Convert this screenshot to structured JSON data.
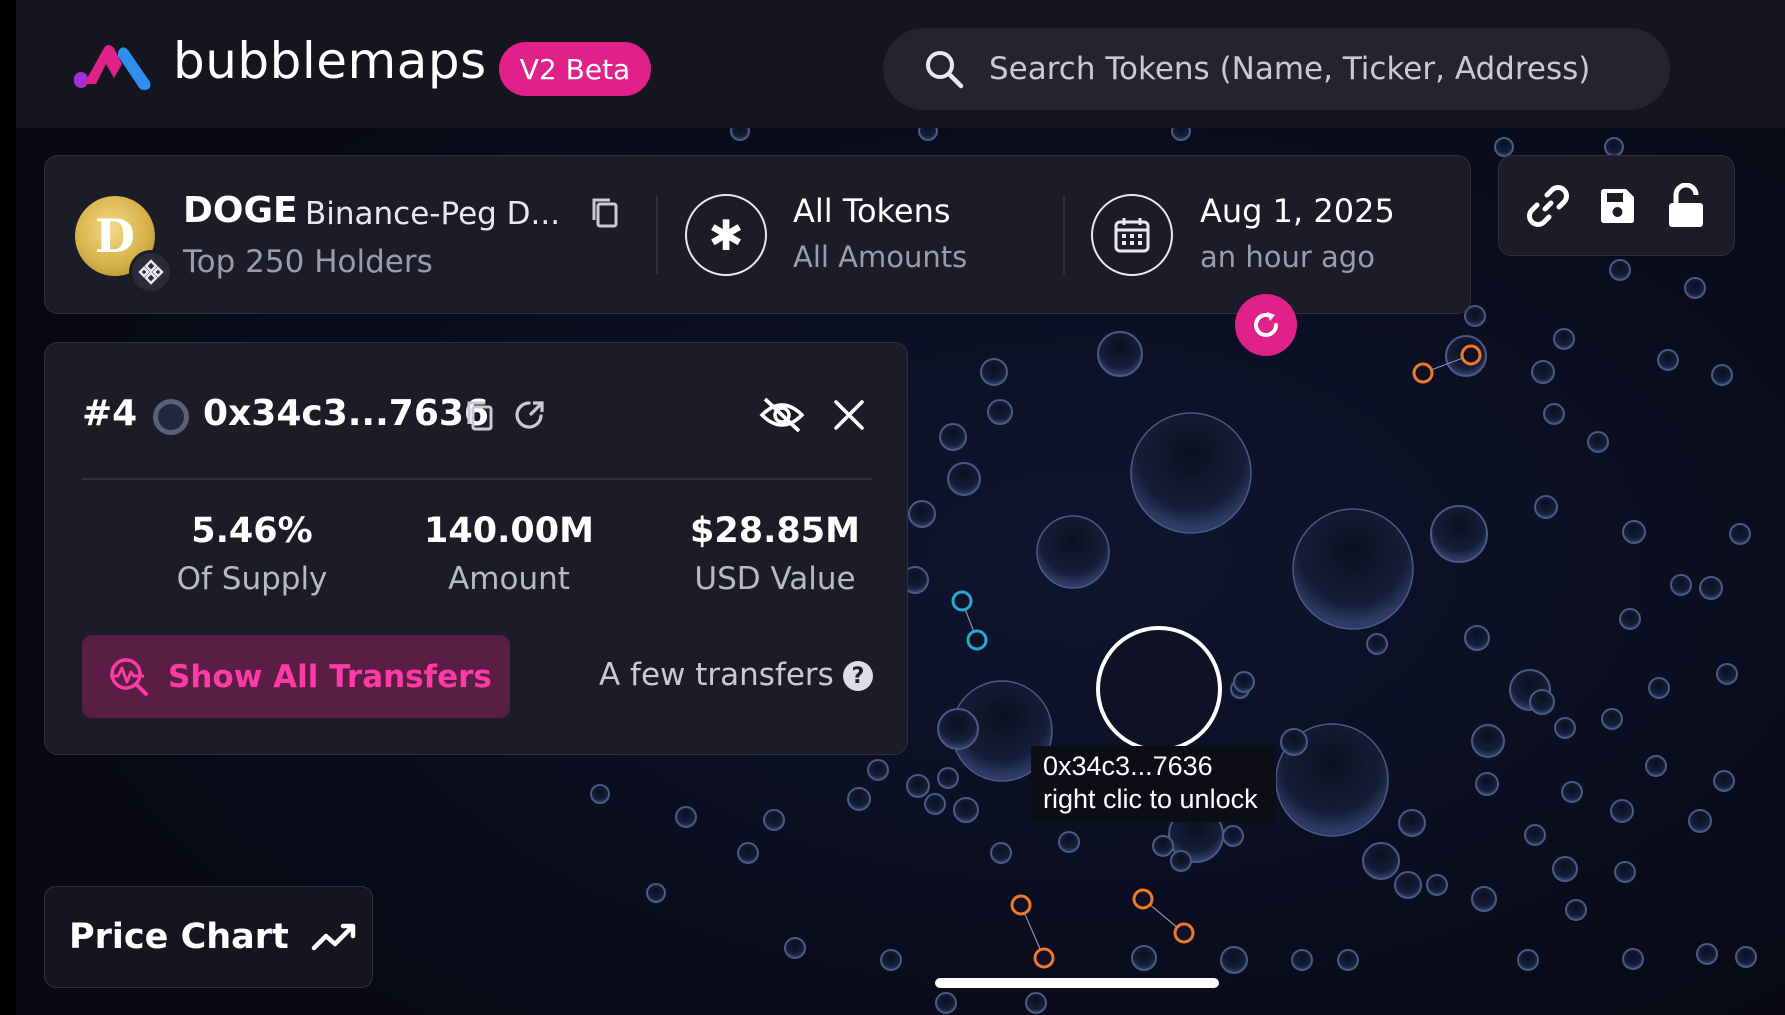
{
  "header": {
    "brand": "bubblemaps",
    "beta_badge": "V2 Beta",
    "search_placeholder": "Search Tokens (Name, Ticker, Address)"
  },
  "token": {
    "symbol": "DOGE",
    "name": "Binance-Peg D...",
    "holders": "Top 250 Holders",
    "avatar_letter": "D"
  },
  "filter": {
    "title": "All Tokens",
    "subtitle": "All Amounts"
  },
  "snapshot": {
    "date": "Aug 1, 2025",
    "relative": "an hour ago"
  },
  "holder": {
    "rank": "#4",
    "address": "0x34c3...7636",
    "stats": [
      {
        "value": "5.46%",
        "label": "Of Supply"
      },
      {
        "value": "140.00M",
        "label": "Amount"
      },
      {
        "value": "$28.85M",
        "label": "USD Value"
      }
    ],
    "show_transfers": "Show All Transfers",
    "transfers_note": "A few transfers",
    "help": "?"
  },
  "tooltip": {
    "line1": "0x34c3...7636",
    "line2": "right clic to unlock"
  },
  "price_chart_label": "Price Chart",
  "colors": {
    "accent": "#e0218a",
    "background": "#0a0b18",
    "panel": "#1b1c28",
    "bubble_stroke": "#4a5a86",
    "orange": "#f07a28",
    "cyan": "#2aa7d6"
  },
  "icons": [
    "logo-icon",
    "search-icon",
    "copy-icon",
    "binance-icon",
    "asterisk-icon",
    "calendar-icon",
    "refresh-icon",
    "link-icon",
    "save-icon",
    "unlock-icon",
    "external-link-icon",
    "eye-off-icon",
    "close-icon",
    "transfers-icon",
    "help-icon",
    "trend-icon"
  ]
}
